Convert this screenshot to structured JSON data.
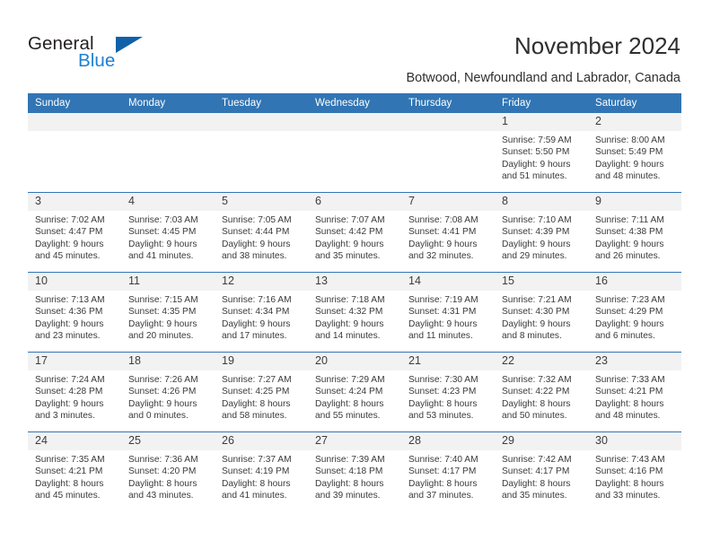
{
  "brand": {
    "name_part1": "General",
    "name_part2": "Blue",
    "logo_icon": "triangle-flag-icon",
    "accent_color": "#1c7fd4"
  },
  "header": {
    "title": "November 2024",
    "subtitle": "Botwood, Newfoundland and Labrador, Canada",
    "header_bg_color": "#3175b4"
  },
  "calendar": {
    "weekday_headers": [
      "Sunday",
      "Monday",
      "Tuesday",
      "Wednesday",
      "Thursday",
      "Friday",
      "Saturday"
    ],
    "weeks": [
      [
        {
          "day": "",
          "sunrise": "",
          "sunset": "",
          "daylight1": "",
          "daylight2": ""
        },
        {
          "day": "",
          "sunrise": "",
          "sunset": "",
          "daylight1": "",
          "daylight2": ""
        },
        {
          "day": "",
          "sunrise": "",
          "sunset": "",
          "daylight1": "",
          "daylight2": ""
        },
        {
          "day": "",
          "sunrise": "",
          "sunset": "",
          "daylight1": "",
          "daylight2": ""
        },
        {
          "day": "",
          "sunrise": "",
          "sunset": "",
          "daylight1": "",
          "daylight2": ""
        },
        {
          "day": "1",
          "sunrise": "Sunrise: 7:59 AM",
          "sunset": "Sunset: 5:50 PM",
          "daylight1": "Daylight: 9 hours",
          "daylight2": "and 51 minutes."
        },
        {
          "day": "2",
          "sunrise": "Sunrise: 8:00 AM",
          "sunset": "Sunset: 5:49 PM",
          "daylight1": "Daylight: 9 hours",
          "daylight2": "and 48 minutes."
        }
      ],
      [
        {
          "day": "3",
          "sunrise": "Sunrise: 7:02 AM",
          "sunset": "Sunset: 4:47 PM",
          "daylight1": "Daylight: 9 hours",
          "daylight2": "and 45 minutes."
        },
        {
          "day": "4",
          "sunrise": "Sunrise: 7:03 AM",
          "sunset": "Sunset: 4:45 PM",
          "daylight1": "Daylight: 9 hours",
          "daylight2": "and 41 minutes."
        },
        {
          "day": "5",
          "sunrise": "Sunrise: 7:05 AM",
          "sunset": "Sunset: 4:44 PM",
          "daylight1": "Daylight: 9 hours",
          "daylight2": "and 38 minutes."
        },
        {
          "day": "6",
          "sunrise": "Sunrise: 7:07 AM",
          "sunset": "Sunset: 4:42 PM",
          "daylight1": "Daylight: 9 hours",
          "daylight2": "and 35 minutes."
        },
        {
          "day": "7",
          "sunrise": "Sunrise: 7:08 AM",
          "sunset": "Sunset: 4:41 PM",
          "daylight1": "Daylight: 9 hours",
          "daylight2": "and 32 minutes."
        },
        {
          "day": "8",
          "sunrise": "Sunrise: 7:10 AM",
          "sunset": "Sunset: 4:39 PM",
          "daylight1": "Daylight: 9 hours",
          "daylight2": "and 29 minutes."
        },
        {
          "day": "9",
          "sunrise": "Sunrise: 7:11 AM",
          "sunset": "Sunset: 4:38 PM",
          "daylight1": "Daylight: 9 hours",
          "daylight2": "and 26 minutes."
        }
      ],
      [
        {
          "day": "10",
          "sunrise": "Sunrise: 7:13 AM",
          "sunset": "Sunset: 4:36 PM",
          "daylight1": "Daylight: 9 hours",
          "daylight2": "and 23 minutes."
        },
        {
          "day": "11",
          "sunrise": "Sunrise: 7:15 AM",
          "sunset": "Sunset: 4:35 PM",
          "daylight1": "Daylight: 9 hours",
          "daylight2": "and 20 minutes."
        },
        {
          "day": "12",
          "sunrise": "Sunrise: 7:16 AM",
          "sunset": "Sunset: 4:34 PM",
          "daylight1": "Daylight: 9 hours",
          "daylight2": "and 17 minutes."
        },
        {
          "day": "13",
          "sunrise": "Sunrise: 7:18 AM",
          "sunset": "Sunset: 4:32 PM",
          "daylight1": "Daylight: 9 hours",
          "daylight2": "and 14 minutes."
        },
        {
          "day": "14",
          "sunrise": "Sunrise: 7:19 AM",
          "sunset": "Sunset: 4:31 PM",
          "daylight1": "Daylight: 9 hours",
          "daylight2": "and 11 minutes."
        },
        {
          "day": "15",
          "sunrise": "Sunrise: 7:21 AM",
          "sunset": "Sunset: 4:30 PM",
          "daylight1": "Daylight: 9 hours",
          "daylight2": "and 8 minutes."
        },
        {
          "day": "16",
          "sunrise": "Sunrise: 7:23 AM",
          "sunset": "Sunset: 4:29 PM",
          "daylight1": "Daylight: 9 hours",
          "daylight2": "and 6 minutes."
        }
      ],
      [
        {
          "day": "17",
          "sunrise": "Sunrise: 7:24 AM",
          "sunset": "Sunset: 4:28 PM",
          "daylight1": "Daylight: 9 hours",
          "daylight2": "and 3 minutes."
        },
        {
          "day": "18",
          "sunrise": "Sunrise: 7:26 AM",
          "sunset": "Sunset: 4:26 PM",
          "daylight1": "Daylight: 9 hours",
          "daylight2": "and 0 minutes."
        },
        {
          "day": "19",
          "sunrise": "Sunrise: 7:27 AM",
          "sunset": "Sunset: 4:25 PM",
          "daylight1": "Daylight: 8 hours",
          "daylight2": "and 58 minutes."
        },
        {
          "day": "20",
          "sunrise": "Sunrise: 7:29 AM",
          "sunset": "Sunset: 4:24 PM",
          "daylight1": "Daylight: 8 hours",
          "daylight2": "and 55 minutes."
        },
        {
          "day": "21",
          "sunrise": "Sunrise: 7:30 AM",
          "sunset": "Sunset: 4:23 PM",
          "daylight1": "Daylight: 8 hours",
          "daylight2": "and 53 minutes."
        },
        {
          "day": "22",
          "sunrise": "Sunrise: 7:32 AM",
          "sunset": "Sunset: 4:22 PM",
          "daylight1": "Daylight: 8 hours",
          "daylight2": "and 50 minutes."
        },
        {
          "day": "23",
          "sunrise": "Sunrise: 7:33 AM",
          "sunset": "Sunset: 4:21 PM",
          "daylight1": "Daylight: 8 hours",
          "daylight2": "and 48 minutes."
        }
      ],
      [
        {
          "day": "24",
          "sunrise": "Sunrise: 7:35 AM",
          "sunset": "Sunset: 4:21 PM",
          "daylight1": "Daylight: 8 hours",
          "daylight2": "and 45 minutes."
        },
        {
          "day": "25",
          "sunrise": "Sunrise: 7:36 AM",
          "sunset": "Sunset: 4:20 PM",
          "daylight1": "Daylight: 8 hours",
          "daylight2": "and 43 minutes."
        },
        {
          "day": "26",
          "sunrise": "Sunrise: 7:37 AM",
          "sunset": "Sunset: 4:19 PM",
          "daylight1": "Daylight: 8 hours",
          "daylight2": "and 41 minutes."
        },
        {
          "day": "27",
          "sunrise": "Sunrise: 7:39 AM",
          "sunset": "Sunset: 4:18 PM",
          "daylight1": "Daylight: 8 hours",
          "daylight2": "and 39 minutes."
        },
        {
          "day": "28",
          "sunrise": "Sunrise: 7:40 AM",
          "sunset": "Sunset: 4:17 PM",
          "daylight1": "Daylight: 8 hours",
          "daylight2": "and 37 minutes."
        },
        {
          "day": "29",
          "sunrise": "Sunrise: 7:42 AM",
          "sunset": "Sunset: 4:17 PM",
          "daylight1": "Daylight: 8 hours",
          "daylight2": "and 35 minutes."
        },
        {
          "day": "30",
          "sunrise": "Sunrise: 7:43 AM",
          "sunset": "Sunset: 4:16 PM",
          "daylight1": "Daylight: 8 hours",
          "daylight2": "and 33 minutes."
        }
      ]
    ]
  }
}
